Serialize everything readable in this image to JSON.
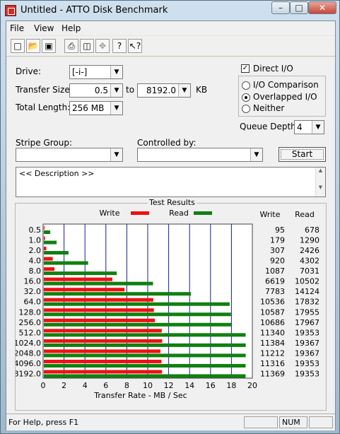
{
  "window": {
    "title": "Untitled - ATTO Disk Benchmark"
  },
  "menu": [
    "File",
    "View",
    "Help"
  ],
  "toolbar": {
    "icons": [
      "new-file-icon",
      "open-folder-icon",
      "save-icon",
      "print-icon",
      "print-preview-icon",
      "move-icon",
      "help-icon",
      "context-help-icon"
    ]
  },
  "form": {
    "drive_label": "Drive:",
    "drive_value": "[-i-]",
    "transfer_size_label": "Transfer Size:",
    "transfer_size_from": "0.5",
    "to_label": "to",
    "transfer_size_to": "8192.0",
    "kb_label": "KB",
    "total_length_label": "Total Length:",
    "total_length_value": "256 MB",
    "direct_io_label": "Direct I/O",
    "direct_io_checked": true,
    "io_comparison_label": "I/O Comparison",
    "overlapped_io_label": "Overlapped I/O",
    "neither_label": "Neither",
    "selected_mode": "Overlapped I/O",
    "queue_depth_label": "Queue Depth:",
    "queue_depth_value": "4",
    "stripe_group_label": "Stripe Group:",
    "stripe_group_value": "",
    "controlled_by_label": "Controlled by:",
    "controlled_by_value": "",
    "start_label": "Start",
    "description_text": "<< Description >>"
  },
  "results": {
    "title": "Test Results",
    "write_legend": "Write",
    "read_legend": "Read",
    "write_col_header": "Write",
    "read_col_header": "Read",
    "colors": {
      "write": "#ee1111",
      "read": "#108010",
      "grid": "#1a1aa0"
    }
  },
  "chart_data": {
    "type": "bar",
    "orientation": "horizontal",
    "categories": [
      "0.5",
      "1.0",
      "2.0",
      "4.0",
      "8.0",
      "16.0",
      "32.0",
      "64.0",
      "128.0",
      "256.0",
      "512.0",
      "1024.0",
      "2048.0",
      "4096.0",
      "8192.0"
    ],
    "series": [
      {
        "name": "Write",
        "values": [
          95,
          179,
          307,
          920,
          1087,
          6619,
          7783,
          10536,
          10587,
          10686,
          11340,
          11384,
          11212,
          11316,
          11369
        ]
      },
      {
        "name": "Read",
        "values": [
          678,
          1290,
          2426,
          4302,
          7031,
          10502,
          14124,
          17832,
          17955,
          17967,
          19353,
          19367,
          19367,
          19353,
          19353
        ]
      }
    ],
    "xlabel": "Transfer Rate - MB / Sec",
    "xlim": [
      0,
      20
    ],
    "xticks": [
      "0",
      "2",
      "4",
      "6",
      "8",
      "10",
      "12",
      "14",
      "16",
      "18",
      "20"
    ],
    "value_unit_note": "bar length = value / 1000"
  },
  "status": {
    "help_text": "For Help, press F1",
    "num_indicator": "NUM"
  }
}
